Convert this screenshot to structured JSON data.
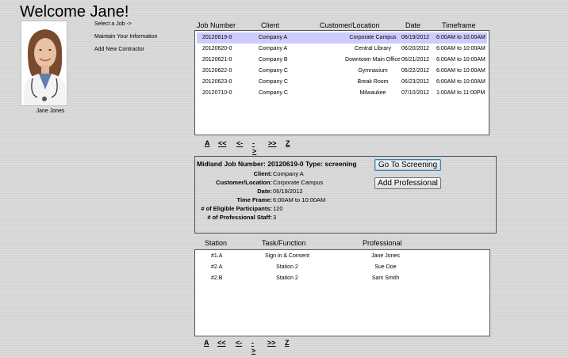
{
  "header": {
    "title": "Welcome Jane!"
  },
  "profile": {
    "name": "Jane Jones"
  },
  "menu": {
    "items": [
      "Select a Job ->",
      "Maintain Your Information",
      "Add New Contractor"
    ]
  },
  "jobs": {
    "columns": [
      "Job Number",
      "Client",
      "Customer/Location",
      "Date",
      "Timeframe"
    ],
    "rows": [
      [
        "20120619-0",
        "Company A",
        "Corporate Campus",
        "06/19/2012",
        "6:00AM to 10:00AM"
      ],
      [
        "20120620-0",
        "Company A",
        "Central Library",
        "06/20/2012",
        "6:00AM to 10:00AM"
      ],
      [
        "20120621-0",
        "Company B",
        "Downtown Main Office",
        "06/21/2012",
        "6:00AM to 10:00AM"
      ],
      [
        "20120622-0",
        "Company C",
        "Gymnasium",
        "06/22/2012",
        "6:00AM to 10:00AM"
      ],
      [
        "20120623-0",
        "Company C",
        "Break Room",
        "06/23/2012",
        "6:00AM to 10:00AM"
      ],
      [
        "20120710-0",
        "Company C",
        "Milwaukee",
        "07/10/2012",
        "1:00AM to 11:00PM"
      ]
    ],
    "selected_row": 0
  },
  "pager": {
    "items": [
      "A",
      "<<",
      "<-",
      "->",
      ">>",
      "Z"
    ]
  },
  "details": {
    "heading": "Midland Job Number: 20120619-0   Type: screening",
    "fields": [
      {
        "label": "Client:",
        "value": "Company A"
      },
      {
        "label": "Customer/Location:",
        "value": "Corporate Campus"
      },
      {
        "label": "Date:",
        "value": "06/19/2012"
      },
      {
        "label": "Time Frame:",
        "value": "6:00AM to 10:00AM"
      },
      {
        "label": "# of Eligible Participants:",
        "value": "120"
      },
      {
        "label": "# of Professional Staff:",
        "value": "3"
      }
    ],
    "goto_label": "Go To Screening",
    "add_label": "Add Professional"
  },
  "staff": {
    "columns": [
      "Station",
      "Task/Function",
      "Professional"
    ],
    "rows": [
      [
        "#1.A",
        "Sign in & Consent",
        "Jane Jones"
      ],
      [
        "#2.A",
        "Station 2",
        "Sue Doe"
      ],
      [
        "#2.B",
        "Station 2",
        "Sam Smith"
      ]
    ]
  },
  "colors": {
    "selected_row": "#ccccff",
    "page_bg": "#d9d9d9"
  },
  "icons": {
    "profile_photo": "avatar-photo"
  }
}
